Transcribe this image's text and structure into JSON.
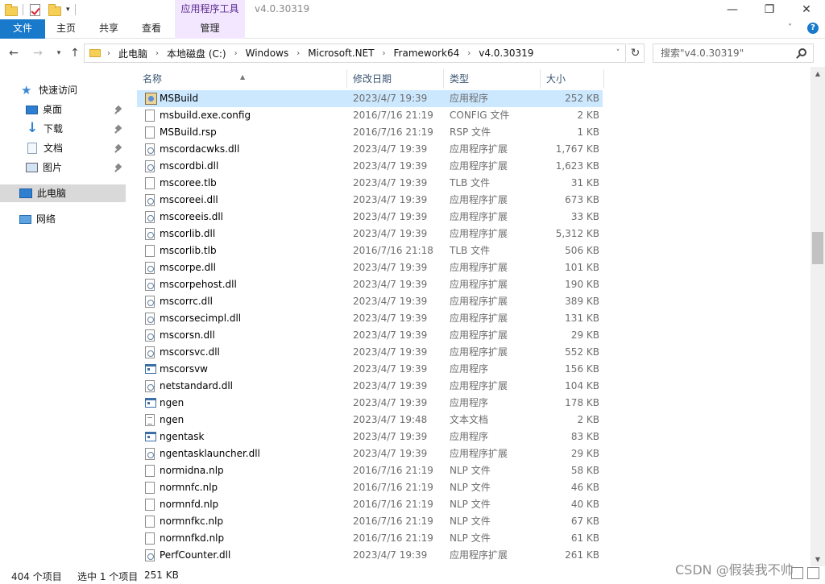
{
  "titlebar": {
    "context_tab_group": "应用程序工具",
    "window_title": "v4.0.30319",
    "minimize": "—",
    "maximize": "❐",
    "close": "✕"
  },
  "ribbon": {
    "tabs": [
      "文件",
      "主页",
      "共享",
      "查看",
      "管理"
    ]
  },
  "address": {
    "crumbs": [
      "此电脑",
      "本地磁盘 (C:)",
      "Windows",
      "Microsoft.NET",
      "Framework64",
      "v4.0.30319"
    ],
    "search_placeholder": "搜索\"v4.0.30319\""
  },
  "nav": {
    "quick_access": "快速访问",
    "desktop": "桌面",
    "downloads": "下载",
    "documents": "文档",
    "pictures": "图片",
    "this_pc": "此电脑",
    "network": "网络"
  },
  "columns": {
    "name": "名称",
    "date": "修改日期",
    "type": "类型",
    "size": "大小"
  },
  "files": [
    {
      "name": "MSBuild",
      "date": "2023/4/7 19:39",
      "type": "应用程序",
      "size": "252 KB",
      "icon": "msbuild-exe",
      "selected": true
    },
    {
      "name": "msbuild.exe.config",
      "date": "2016/7/16 21:19",
      "type": "CONFIG 文件",
      "size": "2 KB",
      "icon": "file"
    },
    {
      "name": "MSBuild.rsp",
      "date": "2016/7/16 21:19",
      "type": "RSP 文件",
      "size": "1 KB",
      "icon": "file"
    },
    {
      "name": "mscordacwks.dll",
      "date": "2023/4/7 19:39",
      "type": "应用程序扩展",
      "size": "1,767 KB",
      "icon": "dll"
    },
    {
      "name": "mscordbi.dll",
      "date": "2023/4/7 19:39",
      "type": "应用程序扩展",
      "size": "1,623 KB",
      "icon": "dll"
    },
    {
      "name": "mscoree.tlb",
      "date": "2023/4/7 19:39",
      "type": "TLB 文件",
      "size": "31 KB",
      "icon": "file"
    },
    {
      "name": "mscoreei.dll",
      "date": "2023/4/7 19:39",
      "type": "应用程序扩展",
      "size": "673 KB",
      "icon": "dll"
    },
    {
      "name": "mscoreeis.dll",
      "date": "2023/4/7 19:39",
      "type": "应用程序扩展",
      "size": "33 KB",
      "icon": "dll"
    },
    {
      "name": "mscorlib.dll",
      "date": "2023/4/7 19:39",
      "type": "应用程序扩展",
      "size": "5,312 KB",
      "icon": "dll"
    },
    {
      "name": "mscorlib.tlb",
      "date": "2016/7/16 21:18",
      "type": "TLB 文件",
      "size": "506 KB",
      "icon": "file"
    },
    {
      "name": "mscorpe.dll",
      "date": "2023/4/7 19:39",
      "type": "应用程序扩展",
      "size": "101 KB",
      "icon": "dll"
    },
    {
      "name": "mscorpehost.dll",
      "date": "2023/4/7 19:39",
      "type": "应用程序扩展",
      "size": "190 KB",
      "icon": "dll"
    },
    {
      "name": "mscorrc.dll",
      "date": "2023/4/7 19:39",
      "type": "应用程序扩展",
      "size": "389 KB",
      "icon": "dll"
    },
    {
      "name": "mscorsecimpl.dll",
      "date": "2023/4/7 19:39",
      "type": "应用程序扩展",
      "size": "131 KB",
      "icon": "dll"
    },
    {
      "name": "mscorsn.dll",
      "date": "2023/4/7 19:39",
      "type": "应用程序扩展",
      "size": "29 KB",
      "icon": "dll"
    },
    {
      "name": "mscorsvc.dll",
      "date": "2023/4/7 19:39",
      "type": "应用程序扩展",
      "size": "552 KB",
      "icon": "dll"
    },
    {
      "name": "mscorsvw",
      "date": "2023/4/7 19:39",
      "type": "应用程序",
      "size": "156 KB",
      "icon": "exe"
    },
    {
      "name": "netstandard.dll",
      "date": "2023/4/7 19:39",
      "type": "应用程序扩展",
      "size": "104 KB",
      "icon": "dll"
    },
    {
      "name": "ngen",
      "date": "2023/4/7 19:39",
      "type": "应用程序",
      "size": "178 KB",
      "icon": "exe"
    },
    {
      "name": "ngen",
      "date": "2023/4/7 19:48",
      "type": "文本文档",
      "size": "2 KB",
      "icon": "txt"
    },
    {
      "name": "ngentask",
      "date": "2023/4/7 19:39",
      "type": "应用程序",
      "size": "83 KB",
      "icon": "exe"
    },
    {
      "name": "ngentasklauncher.dll",
      "date": "2023/4/7 19:39",
      "type": "应用程序扩展",
      "size": "29 KB",
      "icon": "dll"
    },
    {
      "name": "normidna.nlp",
      "date": "2016/7/16 21:19",
      "type": "NLP 文件",
      "size": "58 KB",
      "icon": "file"
    },
    {
      "name": "normnfc.nlp",
      "date": "2016/7/16 21:19",
      "type": "NLP 文件",
      "size": "46 KB",
      "icon": "file"
    },
    {
      "name": "normnfd.nlp",
      "date": "2016/7/16 21:19",
      "type": "NLP 文件",
      "size": "40 KB",
      "icon": "file"
    },
    {
      "name": "normnfkc.nlp",
      "date": "2016/7/16 21:19",
      "type": "NLP 文件",
      "size": "67 KB",
      "icon": "file"
    },
    {
      "name": "normnfkd.nlp",
      "date": "2016/7/16 21:19",
      "type": "NLP 文件",
      "size": "61 KB",
      "icon": "file"
    },
    {
      "name": "PerfCounter.dll",
      "date": "2023/4/7 19:39",
      "type": "应用程序扩展",
      "size": "261 KB",
      "icon": "dll"
    }
  ],
  "status": {
    "item_count": "404 个项目",
    "selected": "选中 1 个项目",
    "selected_size": "251 KB"
  },
  "watermark": "CSDN @假装我不帅",
  "colors": {
    "accent": "#1979ca",
    "selection": "#cce8ff",
    "context_tab": "#f3e7ff"
  }
}
